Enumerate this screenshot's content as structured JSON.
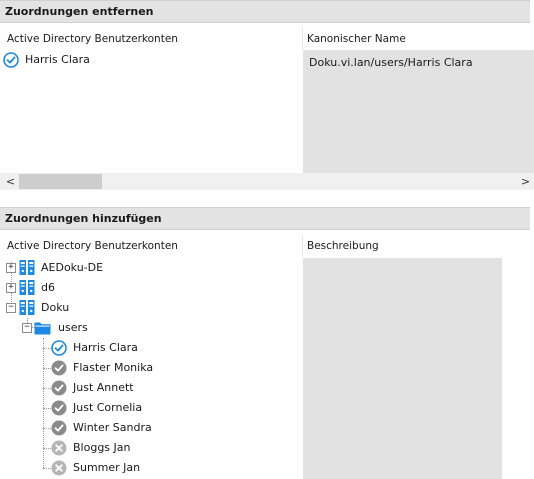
{
  "remove_section": {
    "title": "Zuordnungen entfernen",
    "col_accounts": "Active Directory Benutzerkonten",
    "col_canonical": "Kanonischer Name",
    "rows": [
      {
        "name": "Harris Clara",
        "canonical": "Doku.vi.lan/users/Harris Clara",
        "status": "check-blue"
      }
    ]
  },
  "scrollbar": {
    "left_arrow": "<",
    "right_arrow": ">"
  },
  "add_section": {
    "title": "Zuordnungen hinzufügen",
    "col_accounts": "Active Directory Benutzerkonten",
    "col_description": "Beschreibung",
    "domains": [
      {
        "label": "AEDoku-DE",
        "expander": "+"
      },
      {
        "label": "d6",
        "expander": "+"
      },
      {
        "label": "Doku",
        "expander": "−"
      }
    ],
    "folder": {
      "label": "users",
      "expander": "−"
    },
    "users": [
      {
        "label": "Harris Clara",
        "status": "check-blue"
      },
      {
        "label": "Flaster Monika",
        "status": "check-gray"
      },
      {
        "label": "Just Annett",
        "status": "check-gray"
      },
      {
        "label": "Just Cornelia",
        "status": "check-gray"
      },
      {
        "label": "Winter Sandra",
        "status": "check-gray"
      },
      {
        "label": "Bloggs Jan",
        "status": "cross-gray"
      },
      {
        "label": "Summer Jan",
        "status": "cross-gray"
      }
    ]
  },
  "colors": {
    "accent_blue": "#1e88e5",
    "status_gray": "#8a8a8a",
    "cross_gray": "#b5b5b5"
  }
}
